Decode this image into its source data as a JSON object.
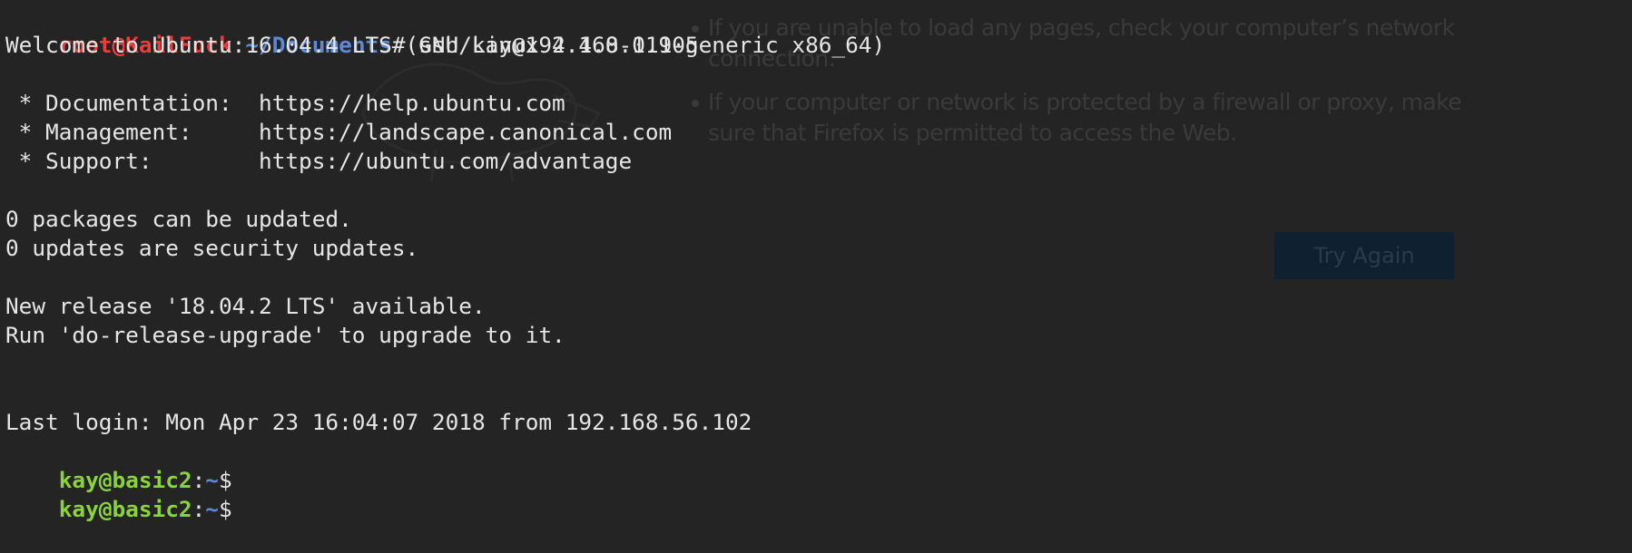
{
  "browser_background": {
    "bullets": [
      "If you are unable to load any pages, check your computer’s network connection.",
      "If your computer or network is protected by a firewall or proxy, make sure that Firefox is permitted to access the Web."
    ],
    "try_again_label": "Try Again"
  },
  "terminal": {
    "prompt_user_host": "root@KailFuck",
    "prompt_colon": ":",
    "prompt_path": "~/Documents",
    "prompt_symbol": "#",
    "command": " ssh kay@192.168.0.105",
    "welcome": "Welcome to Ubuntu 16.04.4 LTS (GNU/Linux 4.4.0-119-generic x86_64)",
    "doc_line": " * Documentation:  https://help.ubuntu.com",
    "mgmt_line": " * Management:     https://landscape.canonical.com",
    "support_line": " * Support:        https://ubuntu.com/advantage",
    "packages_line": "0 packages can be updated.",
    "security_line": "0 updates are security updates.",
    "release_line": "New release '18.04.2 LTS' available.",
    "upgrade_line": "Run 'do-release-upgrade' to upgrade to it.",
    "last_login": "Last login: Mon Apr 23 16:04:07 2018 from 192.168.56.102",
    "remote_prompt_user": "kay@basic2",
    "remote_prompt_colon": ":",
    "remote_prompt_path": "~",
    "remote_prompt_symbol": "$"
  },
  "colors": {
    "background": "#242424",
    "root_prompt": "#ef3b3b",
    "path": "#5b8bd6",
    "user_prompt": "#8ad33b",
    "text": "#e6e6e6"
  }
}
